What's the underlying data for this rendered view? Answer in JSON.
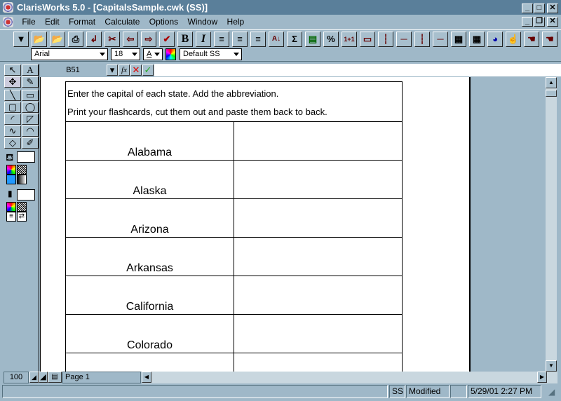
{
  "window": {
    "title": "ClarisWorks 5.0 - [CapitalsSample.cwk (SS)]"
  },
  "menu": [
    "File",
    "Edit",
    "Format",
    "Calculate",
    "Options",
    "Window",
    "Help"
  ],
  "toolbar": {
    "icons": [
      "dropdown",
      "open",
      "save",
      "print",
      "new-doc",
      "cut",
      "copy",
      "paste",
      "spell-check",
      "bold",
      "italic",
      "align-left",
      "align-center",
      "align-right",
      "sort",
      "sum",
      "currency",
      "percent",
      "fill-right",
      "border-outline",
      "border-left",
      "border-top",
      "border-right",
      "border-bottom",
      "page-setup",
      "insert-table",
      "chart",
      "fill-down",
      "help-hand",
      "hand"
    ],
    "bold": "B",
    "italic": "I",
    "sum": "Σ",
    "percent": "%"
  },
  "format": {
    "font": "Arial",
    "size": "18",
    "text_color": "A",
    "style": "Default SS"
  },
  "formula": {
    "cell_ref": "B51",
    "fx": "fx",
    "value": ""
  },
  "sheet": {
    "instructions": [
      "Enter the capital of each state.  Add the abbreviation.",
      "Print your flashcards, cut them out and paste them back to back."
    ],
    "states": [
      "Alabama",
      "Alaska",
      "Arizona",
      "Arkansas",
      "California",
      "Colorado",
      ""
    ]
  },
  "bottom": {
    "zoom": "100",
    "page": "Page 1"
  },
  "status": {
    "mode": "SS",
    "modified": "Modified",
    "datetime": "5/29/01 2:27 PM"
  }
}
